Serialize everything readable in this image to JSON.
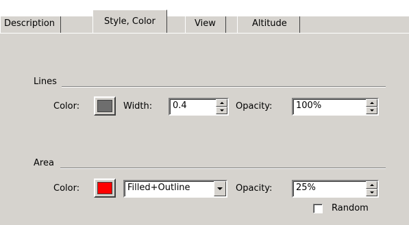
{
  "tabs": [
    {
      "label": "Description",
      "active": false
    },
    {
      "label": "Style, Color",
      "active": true
    },
    {
      "label": "View",
      "active": false
    },
    {
      "label": "Altitude",
      "active": false
    }
  ],
  "lines": {
    "title": "Lines",
    "color_label": "Color:",
    "color": "#6e6e6e",
    "width_label": "Width:",
    "width_value": "0.4",
    "opacity_label": "Opacity:",
    "opacity_value": "100%"
  },
  "area": {
    "title": "Area",
    "color_label": "Color:",
    "color": "#ff0000",
    "fill_mode": "Filled+Outline",
    "opacity_label": "Opacity:",
    "opacity_value": "25%",
    "random_label": "Random",
    "random_checked": false
  }
}
